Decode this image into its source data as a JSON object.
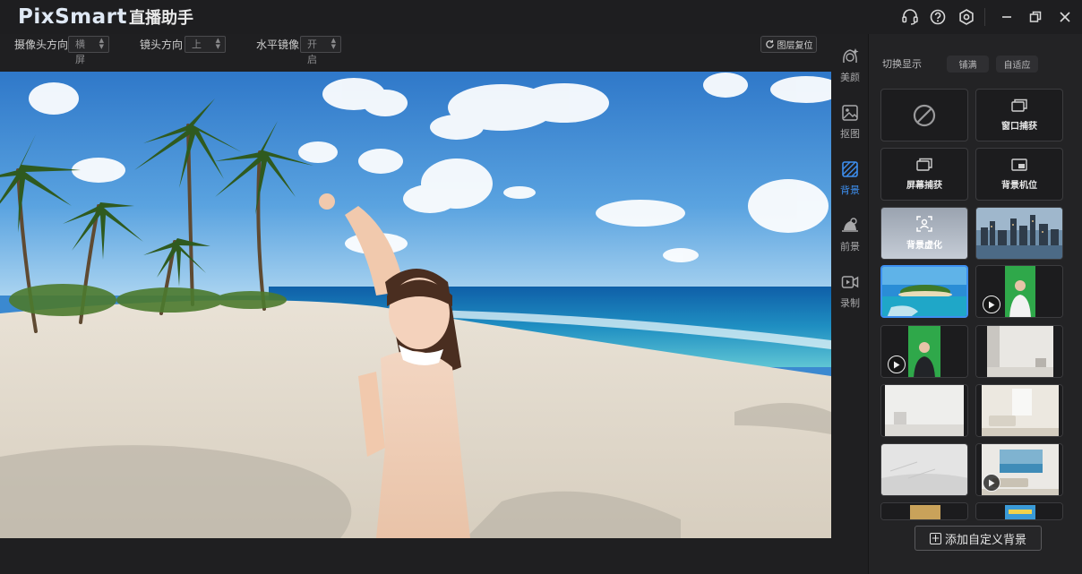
{
  "app": {
    "brand": "PixSmart",
    "sub": "直播助手"
  },
  "titlebar": {
    "icons": [
      "headset-icon",
      "help-icon",
      "settings-icon",
      "minimize-icon",
      "restore-icon",
      "close-icon"
    ]
  },
  "toolbar": {
    "camera_dir_label": "摄像头方向",
    "camera_dir_value": "横屏",
    "lens_dir_label": "镜头方向",
    "lens_dir_value": "上",
    "mirror_label": "水平镜像",
    "mirror_value": "开启",
    "reset_label": "图层复位"
  },
  "nav": {
    "items": [
      {
        "label": "美颜",
        "icon": "beauty-icon"
      },
      {
        "label": "抠图",
        "icon": "matting-icon"
      },
      {
        "label": "背景",
        "icon": "background-icon",
        "active": true
      },
      {
        "label": "前景",
        "icon": "foreground-icon"
      },
      {
        "label": "录制",
        "icon": "record-icon"
      }
    ],
    "active_color": "#3d8ff0"
  },
  "panel": {
    "header": "切换显示",
    "fill_label": "铺满",
    "fit_label": "自适应",
    "items": [
      {
        "kind": "none",
        "label": ""
      },
      {
        "kind": "action",
        "label": "窗口捕获"
      },
      {
        "kind": "action",
        "label": "屏幕捕获"
      },
      {
        "kind": "action",
        "label": "背景机位"
      },
      {
        "kind": "blur",
        "label": "背景虚化"
      },
      {
        "kind": "image",
        "label": ""
      },
      {
        "kind": "image",
        "label": "",
        "selected": true
      },
      {
        "kind": "video",
        "label": ""
      },
      {
        "kind": "video",
        "label": ""
      },
      {
        "kind": "image",
        "label": ""
      },
      {
        "kind": "image",
        "label": ""
      },
      {
        "kind": "image",
        "label": ""
      },
      {
        "kind": "image",
        "label": ""
      },
      {
        "kind": "video",
        "label": ""
      },
      {
        "kind": "image",
        "label": ""
      },
      {
        "kind": "image",
        "label": ""
      }
    ],
    "add_label": "添加自定义背景"
  }
}
